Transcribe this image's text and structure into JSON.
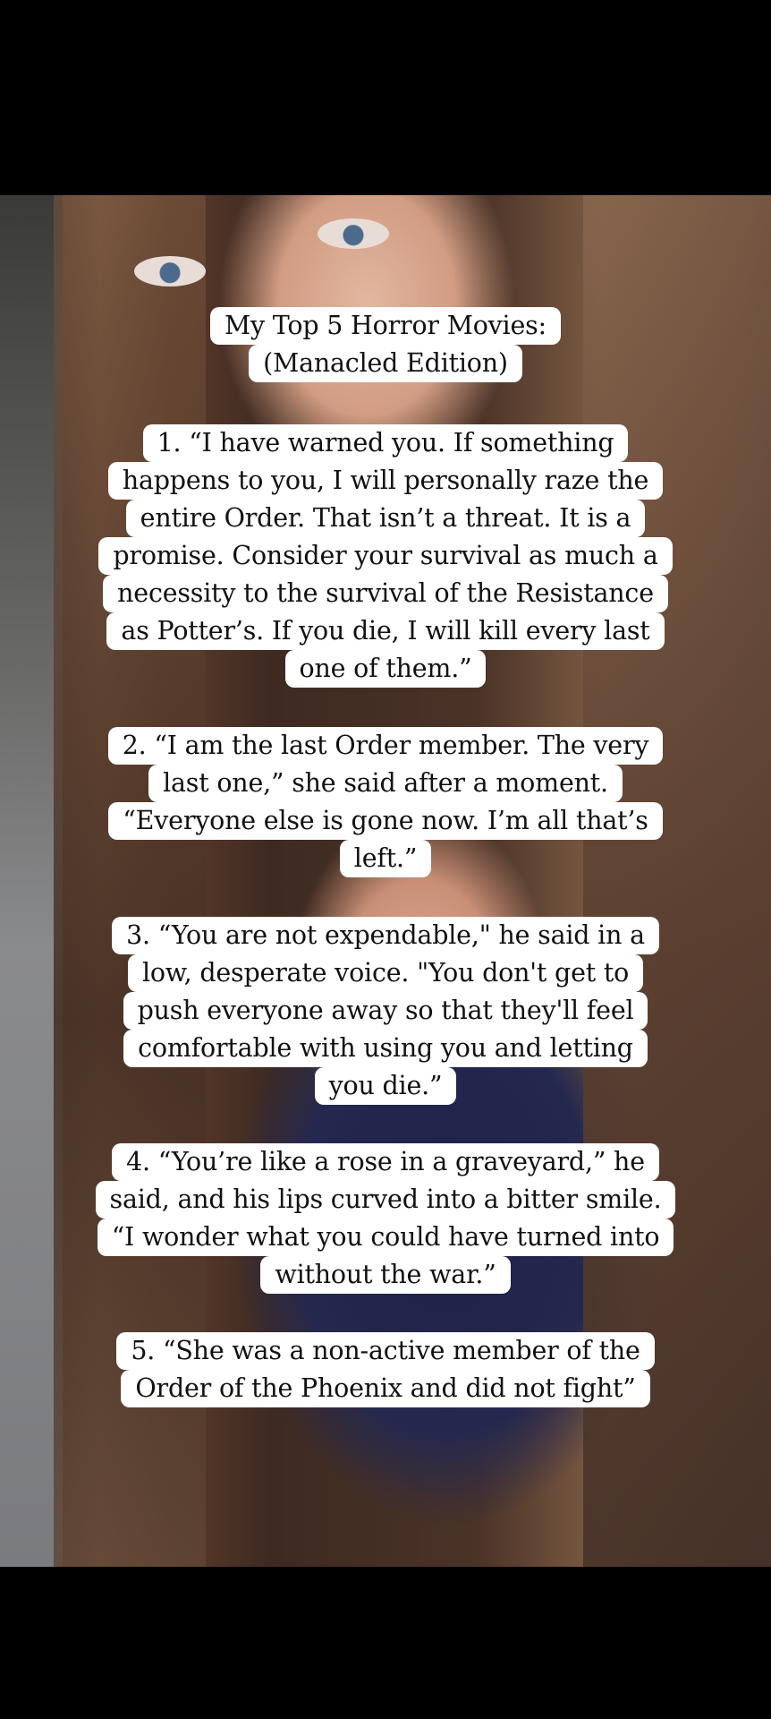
{
  "title": {
    "lines": [
      "My Top 5 Horror Movies:",
      "(Manacled Edition)"
    ]
  },
  "items": [
    {
      "lines": [
        "1. “I have warned you. If something",
        "happens to you, I will personally raze the",
        "entire Order. That isn’t a threat. It is a",
        "promise. Consider your survival as much a",
        "necessity to the survival of the Resistance",
        "as Potter’s. If you die, I will kill every last",
        "one of them.”"
      ]
    },
    {
      "lines": [
        "2. “I am the last Order member. The very",
        "last one,” she said after a moment.",
        "“Everyone else is gone now. I’m all that’s",
        "left.”"
      ]
    },
    {
      "lines": [
        "3. “You are not expendable,\" he said in a",
        "low, desperate voice. \"You don't get to",
        "push everyone away so that they'll feel",
        "comfortable with using you and letting",
        "you die.”"
      ]
    },
    {
      "lines": [
        "4. “You’re like a rose in a graveyard,” he",
        "said, and his lips curved into a bitter smile.",
        "“I wonder what you could have turned into",
        "without the war.”"
      ]
    },
    {
      "lines": [
        "5. “She was a non-active member of the",
        "Order of the Phoenix and did not fight”"
      ]
    }
  ]
}
